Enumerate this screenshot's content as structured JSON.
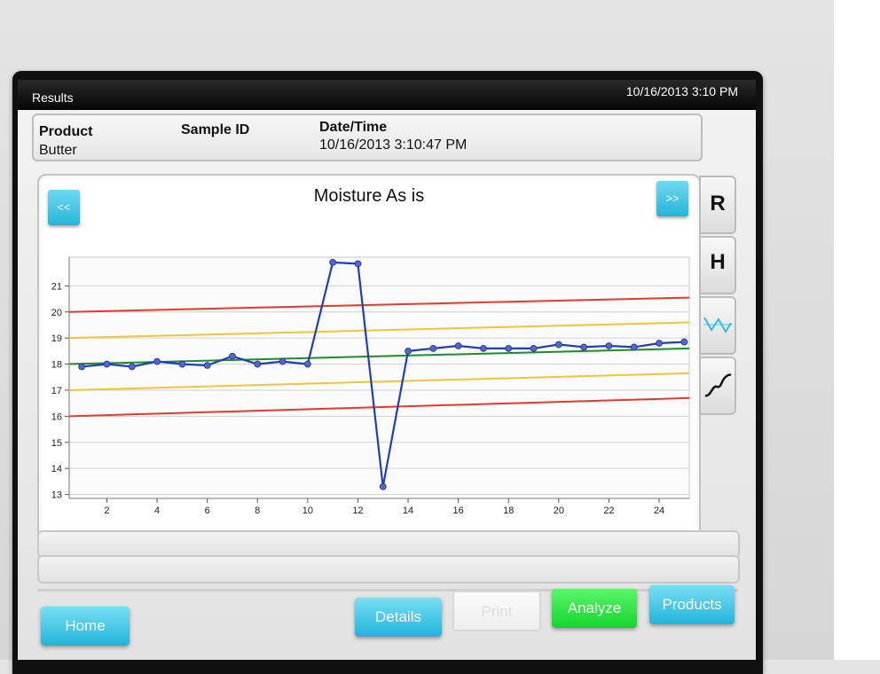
{
  "topbar": {
    "title": "Results",
    "datetime": "10/16/2013 3:10 PM"
  },
  "info": {
    "product_label": "Product",
    "product_value": "Butter",
    "sample_label": "Sample ID",
    "datetime_label": "Date/Time",
    "datetime_value": "10/16/2013 3:10:47 PM"
  },
  "chart_nav": {
    "prev_label": "<<",
    "next_label": ">>"
  },
  "side_tabs": {
    "r_label": "R",
    "h_label": "H"
  },
  "buttons": {
    "home": "Home",
    "details": "Details",
    "print": "Print",
    "analyze": "Analyze",
    "products": "Products"
  },
  "colors": {
    "accent": "#25b5d8",
    "analyze": "#14d52c",
    "series": "#1f3fb5",
    "limit_outer": "#e53b2a",
    "limit_inner": "#f2c33d",
    "target": "#1e8c2a"
  },
  "chart_data": {
    "type": "line",
    "title": "Moisture As is",
    "xlabel": "",
    "ylabel": "",
    "x": [
      1,
      2,
      3,
      4,
      5,
      6,
      7,
      8,
      9,
      10,
      11,
      12,
      13,
      14,
      15,
      16,
      17,
      18,
      19,
      20,
      21,
      22,
      23,
      24,
      25
    ],
    "series": [
      {
        "values": [
          17.9,
          18.0,
          17.9,
          18.1,
          18.0,
          17.95,
          18.3,
          18.0,
          18.1,
          18.0,
          21.9,
          21.85,
          13.3,
          18.5,
          18.6,
          18.7,
          18.6,
          18.6,
          18.6,
          18.75,
          18.65,
          18.7,
          18.65,
          18.8,
          18.85
        ]
      }
    ],
    "reference_lines": [
      {
        "kind": "upper-limit",
        "start": 20.0,
        "end": 20.55
      },
      {
        "kind": "upper-warning",
        "start": 19.0,
        "end": 19.6
      },
      {
        "kind": "target",
        "start": 18.0,
        "end": 18.6
      },
      {
        "kind": "lower-warning",
        "start": 17.0,
        "end": 17.65
      },
      {
        "kind": "lower-limit",
        "start": 16.0,
        "end": 16.7
      }
    ],
    "x_ticks": [
      2,
      4,
      6,
      8,
      10,
      12,
      14,
      16,
      18,
      20,
      22,
      24
    ],
    "y_ticks": [
      13,
      14,
      15,
      16,
      17,
      18,
      19,
      20,
      21
    ],
    "xlim": [
      0.5,
      25.2
    ],
    "ylim": [
      12.85,
      22.1
    ],
    "grid": true
  }
}
